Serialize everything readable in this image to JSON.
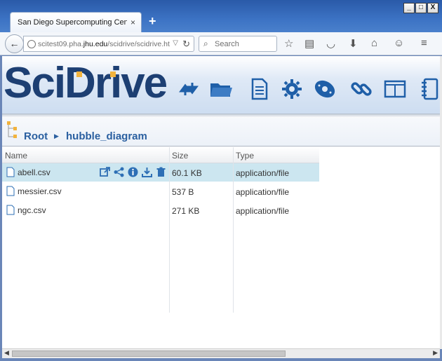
{
  "browser": {
    "tab_title": "San Diego Supercomputing Center...",
    "tab_close": "×",
    "new_tab": "+",
    "window_buttons": [
      "_",
      "□",
      "X"
    ],
    "url_prefix": "scitest09.pha.",
    "url_domain": "jhu.edu",
    "url_suffix": "/scidrive/scidrive.htm",
    "search_placeholder": "Search"
  },
  "app": {
    "logo_text": "SciDrive",
    "nav_icons": [
      "sync-icon",
      "folder-icon",
      "document-icon",
      "gear-icon",
      "hard-drive-icon",
      "link-icon",
      "panel-icon",
      "notebook-icon"
    ]
  },
  "breadcrumb": {
    "items": [
      "Root",
      "hubble_diagram"
    ],
    "separator": "▶"
  },
  "table": {
    "columns": [
      "Name",
      "Size",
      "Type"
    ],
    "rows": [
      {
        "name": "abell.csv",
        "size": "60.1 KB",
        "type": "application/file",
        "selected": true
      },
      {
        "name": "messier.csv",
        "size": "537 B",
        "type": "application/file",
        "selected": false
      },
      {
        "name": "ngc.csv",
        "size": "271 KB",
        "type": "application/file",
        "selected": false
      }
    ],
    "row_actions": [
      "open-external-icon",
      "share-icon",
      "info-icon",
      "download-icon",
      "delete-icon"
    ]
  },
  "colors": {
    "accent": "#1f5fa8",
    "selected_row": "#cce6f0",
    "logo_blue": "#1d3f73",
    "logo_gold": "#f2b33d"
  }
}
